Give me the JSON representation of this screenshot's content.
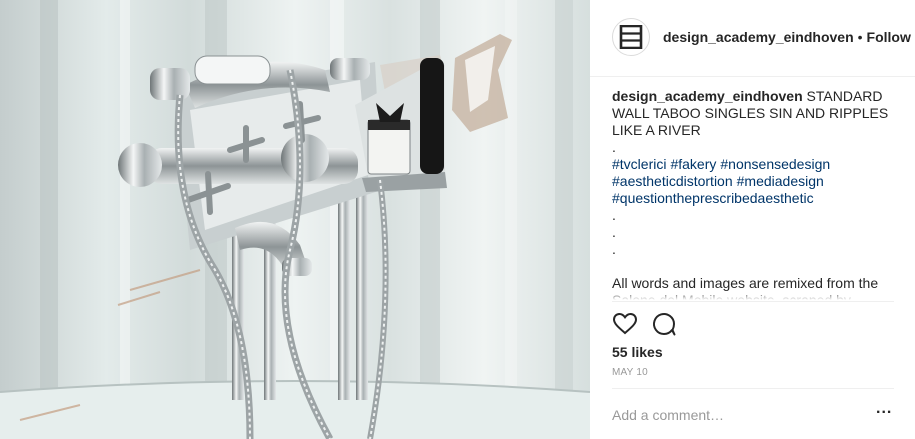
{
  "post": {
    "username": "design_academy_eindhoven",
    "separator": "•",
    "follow_label": "Follow",
    "avatar_icon": "design-academy-logo-icon"
  },
  "caption": {
    "username": "design_academy_eindhoven",
    "text": "STANDARD WALL TABOO SINGLES SIN AND RIPPLES LIKE A RIVER",
    "dot1": ".",
    "hashtags": [
      "#tvclerici",
      "#fakery",
      "#nonsensedesign",
      "#aestheticdistortion",
      "#mediadesign",
      "#questiontheprescribedaesthetic"
    ],
    "dot2": ".",
    "dot3": ".",
    "dot4": ".",
    "remix_note": "All words and images are remixed from the Salone del Mobile website, scraped by"
  },
  "actions": {
    "like_icon": "heart-icon",
    "comment_icon": "comment-bubble-icon"
  },
  "likes_text": "55 likes",
  "date_text": "MAY 10",
  "comment_box": {
    "placeholder": "Add a comment…",
    "more_label": "..."
  },
  "colors": {
    "text": "#262626",
    "muted": "#999999",
    "hashtag": "#003569",
    "divider": "#efefef"
  }
}
